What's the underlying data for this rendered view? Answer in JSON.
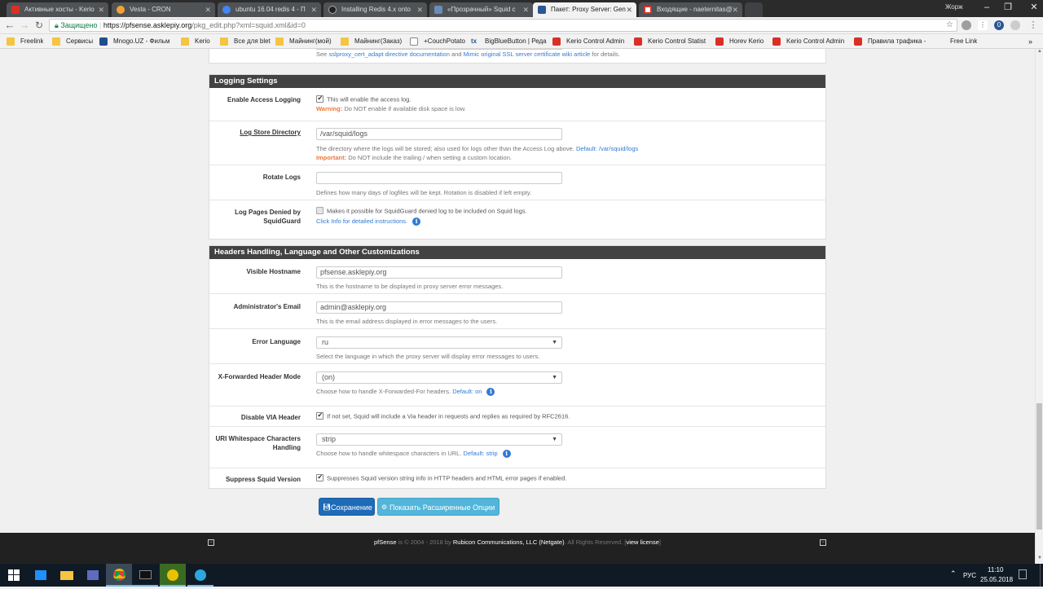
{
  "browser": {
    "tabs": [
      {
        "title": "Активные хосты - Kerio",
        "color": "#d93025"
      },
      {
        "title": "Vesta - CRON",
        "color": "#f4a236"
      },
      {
        "title": "ubuntu 16.04 redis 4 - П",
        "color": "#4285f4"
      },
      {
        "title": "Installing Redis 4.x onto",
        "color": "#222222"
      },
      {
        "title": "«Прозрачный» Squid с",
        "color": "#6b8cb5"
      },
      {
        "title": "Пакет: Proxy Server: Gen",
        "color": "#2b5797"
      },
      {
        "title": "Входящие - naeternitas@",
        "color": "#d93025"
      }
    ],
    "active_tab_index": 5,
    "profile": "Жорж",
    "secure_label": "Защищено",
    "url_host": "https://pfsense.asklepiy.org",
    "url_path": "/pkg_edit.php?xml=squid.xml&id=0",
    "bookmarks": [
      {
        "label": "Freelink",
        "type": "folder"
      },
      {
        "label": "Сервисы",
        "type": "folder"
      },
      {
        "label": "Mnogo.UZ - Фильм",
        "type": "site"
      },
      {
        "label": "Kerio",
        "type": "folder"
      },
      {
        "label": "Все для blet",
        "type": "folder"
      },
      {
        "label": "Майнинг(мой)",
        "type": "folder"
      },
      {
        "label": "Майнинг(Заказ)",
        "type": "folder"
      },
      {
        "label": "+CouchPotato",
        "type": "page"
      },
      {
        "label": "BigBlueButton | Реда",
        "type": "site"
      },
      {
        "label": "Kerio Control Admin",
        "type": "kerio"
      },
      {
        "label": "Kerio Control Statist",
        "type": "kerio"
      },
      {
        "label": "Horev Kerio",
        "type": "kerio"
      },
      {
        "label": "Kerio Control Admin",
        "type": "kerio"
      },
      {
        "label": "Правила трафика -",
        "type": "kerio"
      },
      {
        "label": "Free Link",
        "type": "plain"
      }
    ]
  },
  "top_fragment": {
    "text_prefix": "See",
    "link1": "sslproxy_cert_adapt directive documentation",
    "text_mid": "and",
    "link2": "Mimic original SSL server certificate wiki article",
    "text_suffix": "for details."
  },
  "logging": {
    "title": "Logging Settings",
    "enable_access": {
      "label": "Enable Access Logging",
      "checkbox_text": "This will enable the access log.",
      "warning_label": "Warning:",
      "warning_text": "Do NOT enable if available disk space is low."
    },
    "log_dir": {
      "label": "Log Store Directory",
      "value": "/var/squid/logs",
      "help": "The directory where the logs will be stored; also used for logs other than the Access Log above.",
      "default_label": "Default: /var/squid/logs",
      "important_label": "Important:",
      "important_text": "Do NOT include the trailing / when setting a custom location."
    },
    "rotate": {
      "label": "Rotate Logs",
      "value": "",
      "help": "Defines how many days of logfiles will be kept. Rotation is disabled if left empty."
    },
    "denied": {
      "label": "Log Pages Denied by SquidGuard",
      "checkbox_text": "Makes it possible for SquidGuard denied log to be included on Squid logs.",
      "info_link": "Click Info for detailed instructions."
    }
  },
  "headers": {
    "title": "Headers Handling, Language and Other Customizations",
    "visible_hostname": {
      "label": "Visible Hostname",
      "value": "pfsense.asklepiy.org",
      "help": "This is the hostname to be displayed in proxy server error messages."
    },
    "admin_email": {
      "label": "Administrator's Email",
      "value": "admin@asklepiy.org",
      "help": "This is the email address displayed in error messages to the users."
    },
    "error_language": {
      "label": "Error Language",
      "value": "ru",
      "help": "Select the language in which the proxy server will display error messages to users."
    },
    "xff_mode": {
      "label": "X-Forwarded Header Mode",
      "value": "(on)",
      "help": "Choose how to handle X-Forwarded-For headers.",
      "default_label": "Default: on"
    },
    "disable_via": {
      "label": "Disable VIA Header",
      "checkbox_text": "If not set, Squid will include a Via header in requests and replies as required by RFC2616."
    },
    "uri_whitespace": {
      "label": "URI Whitespace Characters Handling",
      "value": "strip",
      "help": "Choose how to handle whitespace characters in URL.",
      "default_label": "Default: strip"
    },
    "suppress_version": {
      "label": "Suppress Squid Version",
      "checkbox_text": "Suppresses Squid version string info in HTTP headers and HTML error pages if enabled."
    }
  },
  "buttons": {
    "save": "Сохранение",
    "advanced": "Показать Расширенные Опции"
  },
  "footer": {
    "brand": "pfSense",
    "copy_text": "is © 2004 - 2018 by",
    "company": "Rubicon Communications, LLC (Netgate)",
    "rights": ". All Rights Reserved. [",
    "license_link": "view license",
    "close_bracket": "]"
  },
  "taskbar": {
    "lang": "РУС",
    "time": "11:10",
    "date": "25.05.2018"
  }
}
